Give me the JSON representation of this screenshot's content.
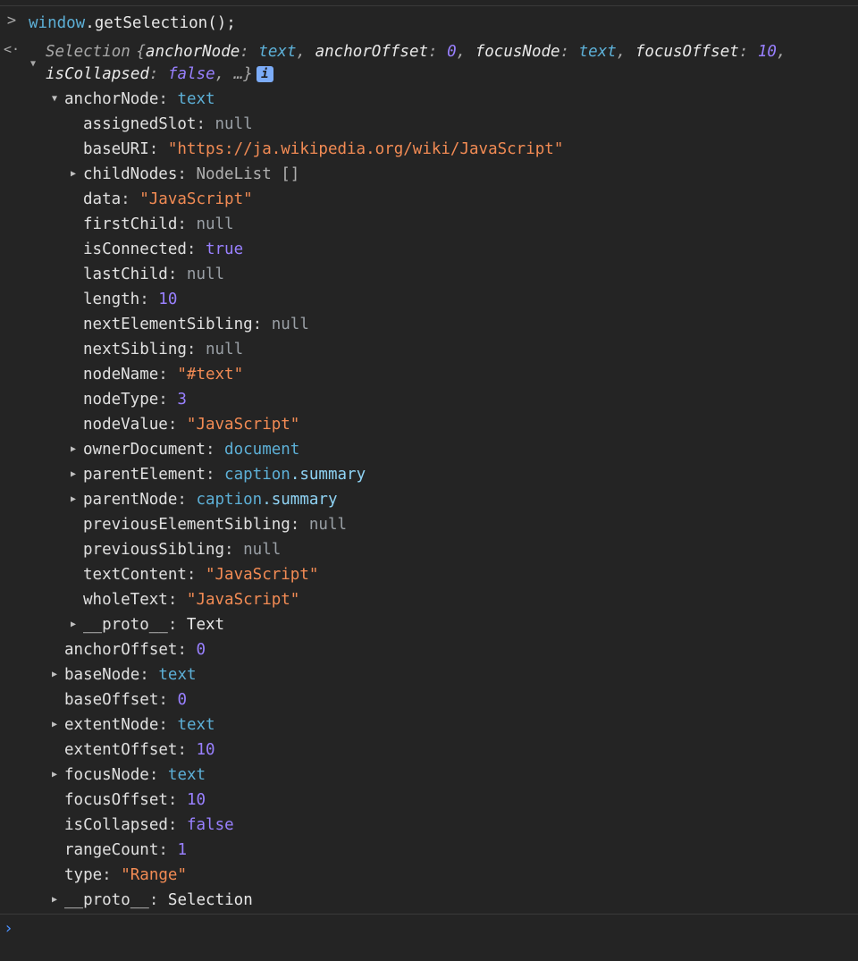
{
  "console": {
    "input": {
      "prompt_glyph": ">",
      "object": "window",
      "method": ".getSelection",
      "suffix": "();"
    },
    "result_glyph": "<·",
    "summary": {
      "class_name": "Selection",
      "open_brace": "{",
      "parts": [
        {
          "key": "anchorNode",
          "value": "text",
          "type": "ent"
        },
        {
          "key": "anchorOffset",
          "value": "0",
          "type": "num"
        },
        {
          "key": "focusNode",
          "value": "text",
          "type": "ent"
        },
        {
          "key": "focusOffset",
          "value": "10",
          "type": "num"
        },
        {
          "key": "isCollapsed",
          "value": "false",
          "type": "kw"
        }
      ],
      "ellipsis": "…}",
      "info_icon": "i"
    },
    "rows": [
      {
        "indent": 1,
        "arrow": "expanded",
        "key": "anchorNode",
        "value": "text",
        "type": "ent"
      },
      {
        "indent": 2,
        "arrow": "",
        "key": "assignedSlot",
        "value": "null",
        "type": "nul"
      },
      {
        "indent": 2,
        "arrow": "",
        "key": "baseURI",
        "value": "\"https://ja.wikipedia.org/wiki/JavaScript\"",
        "type": "str"
      },
      {
        "indent": 2,
        "arrow": "collapsed",
        "key": "childNodes",
        "value": "NodeList []",
        "type": "cls"
      },
      {
        "indent": 2,
        "arrow": "",
        "key": "data",
        "value": "\"JavaScript\"",
        "type": "str"
      },
      {
        "indent": 2,
        "arrow": "",
        "key": "firstChild",
        "value": "null",
        "type": "nul"
      },
      {
        "indent": 2,
        "arrow": "",
        "key": "isConnected",
        "value": "true",
        "type": "kw"
      },
      {
        "indent": 2,
        "arrow": "",
        "key": "lastChild",
        "value": "null",
        "type": "nul"
      },
      {
        "indent": 2,
        "arrow": "",
        "key": "length",
        "value": "10",
        "type": "num"
      },
      {
        "indent": 2,
        "arrow": "",
        "key": "nextElementSibling",
        "value": "null",
        "type": "nul"
      },
      {
        "indent": 2,
        "arrow": "",
        "key": "nextSibling",
        "value": "null",
        "type": "nul"
      },
      {
        "indent": 2,
        "arrow": "",
        "key": "nodeName",
        "value": "\"#text\"",
        "type": "str"
      },
      {
        "indent": 2,
        "arrow": "",
        "key": "nodeType",
        "value": "3",
        "type": "num"
      },
      {
        "indent": 2,
        "arrow": "",
        "key": "nodeValue",
        "value": "\"JavaScript\"",
        "type": "str"
      },
      {
        "indent": 2,
        "arrow": "collapsed",
        "key": "ownerDocument",
        "value": "document",
        "type": "ent"
      },
      {
        "indent": 2,
        "arrow": "collapsed",
        "key": "parentElement",
        "value": "caption",
        "value2": ".summary",
        "type": "ent"
      },
      {
        "indent": 2,
        "arrow": "collapsed",
        "key": "parentNode",
        "value": "caption",
        "value2": ".summary",
        "type": "ent"
      },
      {
        "indent": 2,
        "arrow": "",
        "key": "previousElementSibling",
        "value": "null",
        "type": "nul"
      },
      {
        "indent": 2,
        "arrow": "",
        "key": "previousSibling",
        "value": "null",
        "type": "nul"
      },
      {
        "indent": 2,
        "arrow": "",
        "key": "textContent",
        "value": "\"JavaScript\"",
        "type": "str"
      },
      {
        "indent": 2,
        "arrow": "",
        "key": "wholeText",
        "value": "\"JavaScript\"",
        "type": "str"
      },
      {
        "indent": 2,
        "arrow": "collapsed",
        "key": "__proto__",
        "value": "Text",
        "type": "bright"
      },
      {
        "indent": 1,
        "arrow": "",
        "key": "anchorOffset",
        "value": "0",
        "type": "num"
      },
      {
        "indent": 1,
        "arrow": "collapsed",
        "key": "baseNode",
        "value": "text",
        "type": "ent"
      },
      {
        "indent": 1,
        "arrow": "",
        "key": "baseOffset",
        "value": "0",
        "type": "num"
      },
      {
        "indent": 1,
        "arrow": "collapsed",
        "key": "extentNode",
        "value": "text",
        "type": "ent"
      },
      {
        "indent": 1,
        "arrow": "",
        "key": "extentOffset",
        "value": "10",
        "type": "num"
      },
      {
        "indent": 1,
        "arrow": "collapsed",
        "key": "focusNode",
        "value": "text",
        "type": "ent"
      },
      {
        "indent": 1,
        "arrow": "",
        "key": "focusOffset",
        "value": "10",
        "type": "num"
      },
      {
        "indent": 1,
        "arrow": "",
        "key": "isCollapsed",
        "value": "false",
        "type": "kw"
      },
      {
        "indent": 1,
        "arrow": "",
        "key": "rangeCount",
        "value": "1",
        "type": "num"
      },
      {
        "indent": 1,
        "arrow": "",
        "key": "type",
        "value": "\"Range\"",
        "type": "str"
      },
      {
        "indent": 1,
        "arrow": "collapsed",
        "key": "__proto__",
        "value": "Selection",
        "type": "bright"
      }
    ],
    "bottom_prompt_glyph": "›"
  },
  "colors": {
    "background": "#242424",
    "string": "#f28b54",
    "number": "#9980ff",
    "entity": "#5db0d7",
    "null": "#9aa0a6",
    "prompt_blue": "#4a90ff"
  },
  "icons": {
    "prompt": "chevron-right-icon",
    "result": "return-arrow-icon",
    "expanded": "triangle-down-icon",
    "collapsed": "triangle-right-icon",
    "info": "info-icon"
  }
}
